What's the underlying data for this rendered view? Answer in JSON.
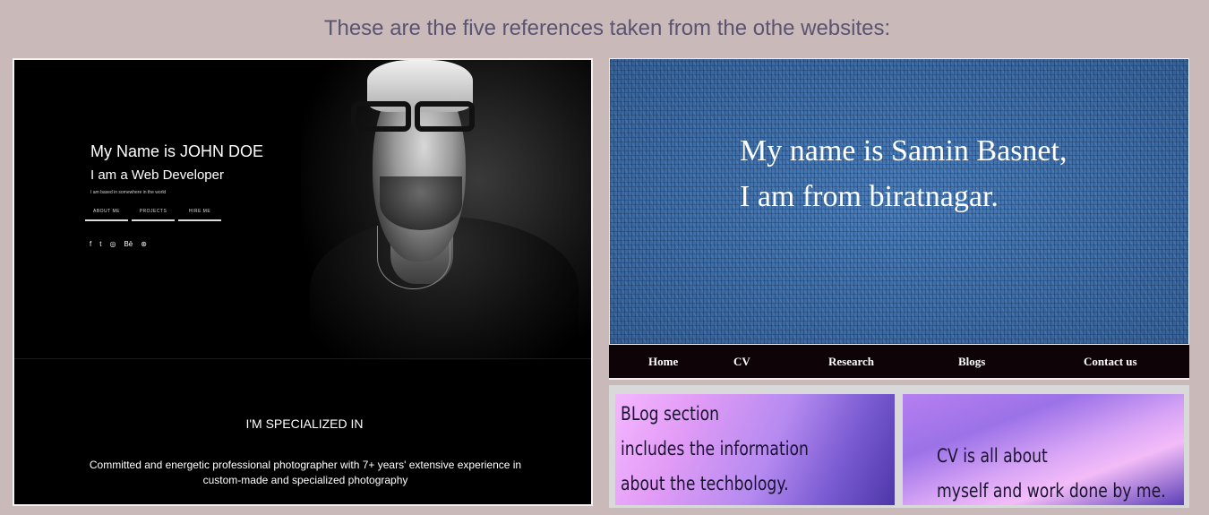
{
  "heading": "These are the five references taken from the othe websites:",
  "ref1": {
    "name_line": "My Name is JOHN DOE",
    "role_line": "I am a Web Developer",
    "based_line": "I am based in somewhere in the world",
    "buttons": [
      "ABOUT ME",
      "PROJECTS",
      "HIRE ME"
    ],
    "social_icons": [
      "facebook-icon",
      "twitter-icon",
      "instagram-icon",
      "behance-icon",
      "dribbble-icon"
    ],
    "social_glyphs": [
      "f",
      "t",
      "◎",
      "Bē",
      "⊛"
    ],
    "section_title": "I'M SPECIALIZED IN",
    "description": "Committed and energetic professional photographer with 7+ years' extensive experience in custom-made and specialized photography"
  },
  "ref2": {
    "hero_line_1": "My name is Samin Basnet,",
    "hero_line_2": "I am from biratnagar.",
    "nav": [
      "Home",
      "CV",
      "Research",
      "Blogs",
      "Contact us"
    ],
    "blog_card": [
      "BLog section",
      "includes the information",
      "about the techbology."
    ],
    "cv_card": [
      "CV is all about",
      "myself and work done by me."
    ]
  },
  "colors": {
    "page_bg": "#c9b9b9",
    "heading_text": "#5a5470",
    "hero_blue": "#3f6fa8",
    "navbar_bg": "#0e0306"
  }
}
